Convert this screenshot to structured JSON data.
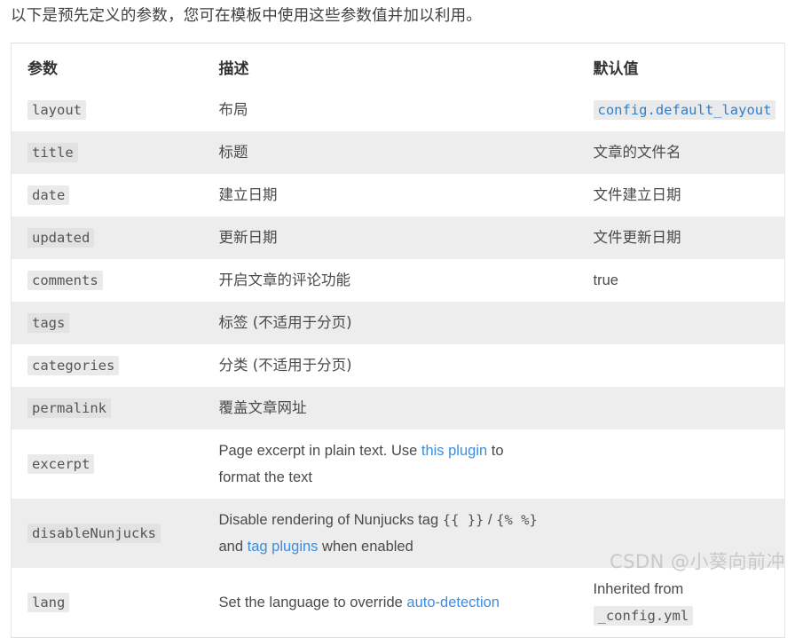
{
  "intro": "以下是预先定义的参数，您可在模板中使用这些参数值并加以利用。",
  "table": {
    "headers": {
      "parameter": "参数",
      "description": "描述",
      "default": "默认值"
    },
    "rows": [
      {
        "param": "layout",
        "desc": "布局",
        "default": "config.default_layout",
        "default_kind": "code-link",
        "shade": "plain"
      },
      {
        "param": "title",
        "desc": "标题",
        "default": "文章的文件名",
        "default_kind": "text",
        "shade": "alt"
      },
      {
        "param": "date",
        "desc": "建立日期",
        "default": "文件建立日期",
        "default_kind": "text",
        "shade": "plain"
      },
      {
        "param": "updated",
        "desc": "更新日期",
        "default": "文件更新日期",
        "default_kind": "text",
        "shade": "alt"
      },
      {
        "param": "comments",
        "desc": "开启文章的评论功能",
        "default": "true",
        "default_kind": "text",
        "shade": "plain"
      },
      {
        "param": "tags",
        "desc": "标签 (不适用于分页)",
        "default": "",
        "default_kind": "text",
        "shade": "alt"
      },
      {
        "param": "categories",
        "desc": "分类 (不适用于分页)",
        "default": "",
        "default_kind": "text",
        "shade": "plain"
      },
      {
        "param": "permalink",
        "desc": "覆盖文章网址",
        "default": "",
        "default_kind": "text",
        "shade": "alt"
      },
      {
        "param": "excerpt",
        "desc_parts": {
          "before": "Page excerpt in plain text. Use ",
          "link": "this plugin",
          "after": " to format the text"
        },
        "default": "",
        "default_kind": "text",
        "shade": "plain"
      },
      {
        "param": "disableNunjucks",
        "desc_parts": {
          "before": "Disable rendering of Nunjucks tag ",
          "code1": "{{ }}",
          "slash": " / ",
          "code2": "{% %}",
          "mid": " and ",
          "link": "tag plugins",
          "after": " when enabled"
        },
        "default": "",
        "default_kind": "text",
        "shade": "alt"
      },
      {
        "param": "lang",
        "desc_parts": {
          "before": "Set the language to override ",
          "link": "auto-detection",
          "after": ""
        },
        "default_prefix": "Inherited from ",
        "default_code": "_config.yml",
        "default_kind": "text-code",
        "shade": "plain"
      }
    ]
  },
  "watermark": "CSDN @小葵向前冲",
  "colors": {
    "link": "#3c8dde",
    "code_link": "#2f7fd1",
    "alt_row": "#ededed",
    "text": "#4a4a4a"
  }
}
